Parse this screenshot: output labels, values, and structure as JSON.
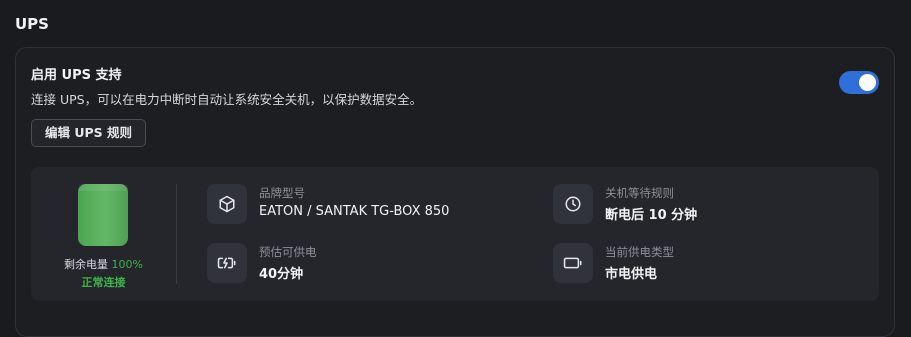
{
  "section": {
    "title": "UPS"
  },
  "enable": {
    "title": "启用 UPS 支持",
    "description": "连接 UPS，可以在电力中断时自动让系统安全关机，以保护数据安全。",
    "enabled": true
  },
  "edit_button": {
    "label": "编辑 UPS 规则"
  },
  "battery": {
    "label": "剩余电量",
    "percent": "100%",
    "status": "正常连接",
    "level": 1.0,
    "color": "#5cb360"
  },
  "info": {
    "brand": {
      "label": "品牌型号",
      "value": "EATON / SANTAK TG-BOX 850",
      "icon": "box-icon"
    },
    "shutdown_rule": {
      "label": "关机等待规则",
      "value": "断电后 10 分钟",
      "icon": "clock-icon"
    },
    "runtime": {
      "label": "预估可供电",
      "value": "40分钟",
      "icon": "battery-charging-icon"
    },
    "power_type": {
      "label": "当前供电类型",
      "value": "市电供电",
      "icon": "battery-icon"
    }
  },
  "colors": {
    "accent": "#2f6fd8",
    "ok": "#3fb24a"
  }
}
